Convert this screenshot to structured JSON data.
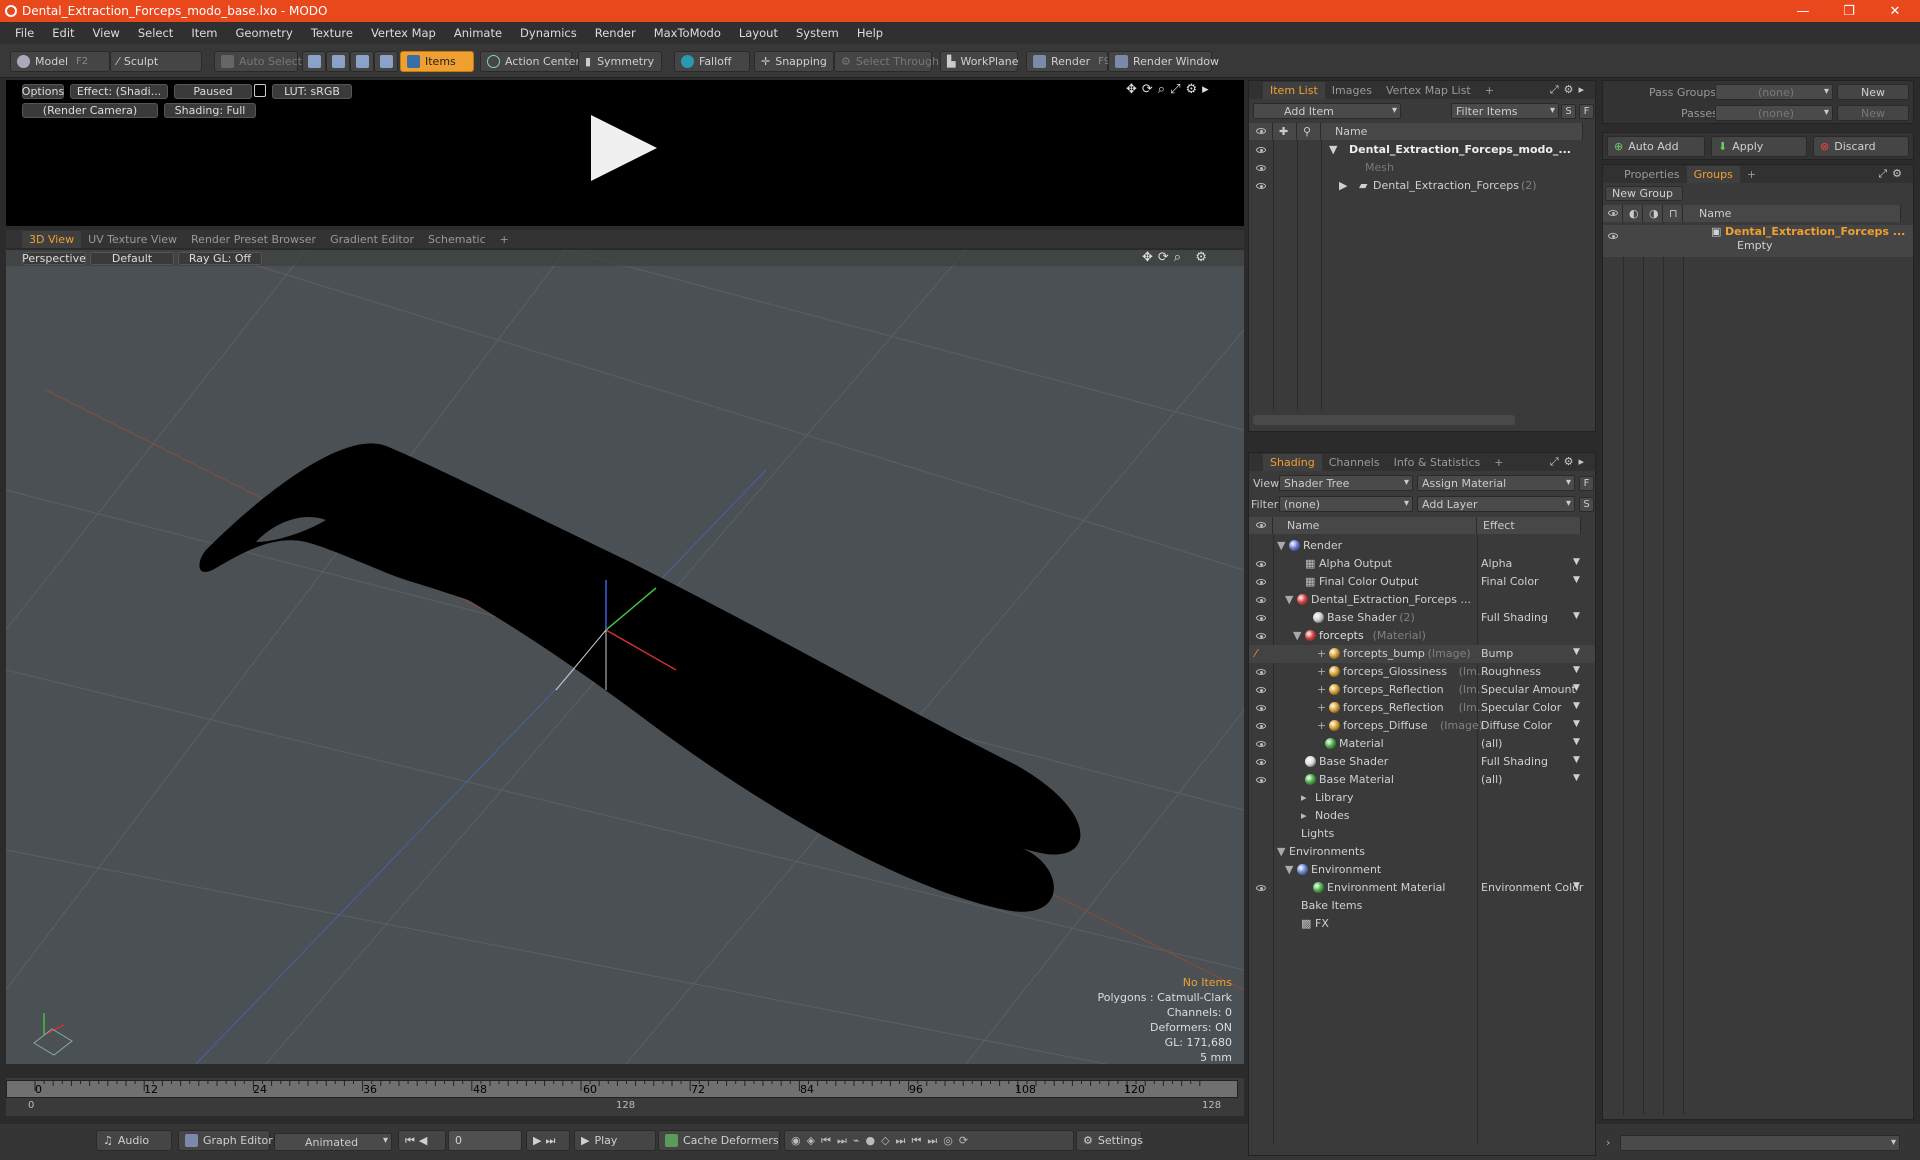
{
  "window": {
    "title": "Dental_Extraction_Forceps_modo_base.lxo - MODO",
    "min": "—",
    "max": "❐",
    "close": "✕"
  },
  "menu": [
    "File",
    "Edit",
    "View",
    "Select",
    "Item",
    "Geometry",
    "Texture",
    "Vertex Map",
    "Animate",
    "Dynamics",
    "Render",
    "MaxToModo",
    "Layout",
    "System",
    "Help"
  ],
  "toolbar": {
    "model": "Model",
    "model_key": "F2",
    "sculpt": "Sculpt",
    "auto_select": "Auto Select",
    "items": "Items",
    "action_center": "Action Center",
    "symmetry": "Symmetry",
    "falloff": "Falloff",
    "snapping": "Snapping",
    "select_through": "Select Through",
    "workplane": "WorkPlane",
    "render": "Render",
    "render_key": "F9",
    "render_window": "Render Window"
  },
  "preview": {
    "options": "Options",
    "effect": "Effect: (Shadi...",
    "paused": "Paused",
    "lut": "LUT: sRGB",
    "camera": "(Render Camera)",
    "shading": "Shading: Full"
  },
  "viewport_tabs": [
    "3D View",
    "UV Texture View",
    "Render Preset Browser",
    "Gradient Editor",
    "Schematic",
    "+"
  ],
  "viewport": {
    "perspective": "Perspective",
    "default": "Default",
    "raygl": "Ray GL: Off"
  },
  "hud": {
    "no_items": "No Items",
    "polygons": "Polygons : Catmull-Clark",
    "channels": "Channels: 0",
    "deformers": "Deformers: ON",
    "gl": "GL: 171,680",
    "scale": "5 mm"
  },
  "timeline": {
    "ticks": [
      "0",
      "12",
      "24",
      "36",
      "48",
      "60",
      "72",
      "84",
      "96",
      "108",
      "120"
    ],
    "start": "0",
    "mid": "128",
    "end": "128"
  },
  "bottom": {
    "audio": "Audio",
    "graph_editor": "Graph Editor",
    "animated": "Animated",
    "frame": "0",
    "play": "Play",
    "cache": "Cache Deformers",
    "settings": "Settings"
  },
  "item_panel": {
    "tabs": [
      "Item List",
      "Images",
      "Vertex Map List",
      "+"
    ],
    "add_item": "Add Item",
    "filter_items": "Filter Items",
    "s": "S",
    "f": "F",
    "col_name": "Name",
    "rows": [
      {
        "label": "Dental_Extraction_Forceps_modo_...",
        "sub": ""
      },
      {
        "label": "Mesh",
        "sub": ""
      },
      {
        "label": "Dental_Extraction_Forceps",
        "sub": "(2)"
      }
    ]
  },
  "shading_panel": {
    "tabs": [
      "Shading",
      "Channels",
      "Info & Statistics",
      "+"
    ],
    "view_label": "View",
    "view": "Shader Tree",
    "assign": "Assign Material",
    "filter_label": "Filter",
    "filter": "(none)",
    "add_layer": "Add Layer",
    "col_name": "Name",
    "col_effect": "Effect",
    "rows": [
      {
        "label": "Render",
        "sub": "",
        "effect": ""
      },
      {
        "label": "Alpha Output",
        "sub": "",
        "effect": "Alpha"
      },
      {
        "label": "Final Color Output",
        "sub": "",
        "effect": "Final Color"
      },
      {
        "label": "Dental_Extraction_Forceps ...",
        "sub": "",
        "effect": ""
      },
      {
        "label": "Base Shader",
        "sub": "(2)",
        "effect": "Full Shading"
      },
      {
        "label": "forcepts",
        "sub": "(Material)",
        "effect": ""
      },
      {
        "label": "forcepts_bump",
        "sub": "(Image)",
        "effect": "Bump"
      },
      {
        "label": "forceps_Glossiness",
        "sub": "(Im...",
        "effect": "Roughness"
      },
      {
        "label": "forceps_Reflection",
        "sub": "(Im...",
        "effect": "Specular Amount"
      },
      {
        "label": "forceps_Reflection",
        "sub": "(Im...",
        "effect": "Specular Color"
      },
      {
        "label": "forceps_Diffuse",
        "sub": "(Image)",
        "effect": "Diffuse Color"
      },
      {
        "label": "Material",
        "sub": "",
        "effect": "(all)"
      },
      {
        "label": "Base Shader",
        "sub": "",
        "effect": "Full Shading"
      },
      {
        "label": "Base Material",
        "sub": "",
        "effect": "(all)"
      },
      {
        "label": "Library",
        "sub": "",
        "effect": ""
      },
      {
        "label": "Nodes",
        "sub": "",
        "effect": ""
      },
      {
        "label": "Lights",
        "sub": "",
        "effect": ""
      },
      {
        "label": "Environments",
        "sub": "",
        "effect": ""
      },
      {
        "label": "Environment",
        "sub": "",
        "effect": ""
      },
      {
        "label": "Environment Material",
        "sub": "",
        "effect": "Environment Color"
      },
      {
        "label": "Bake Items",
        "sub": "",
        "effect": ""
      },
      {
        "label": "FX",
        "sub": "",
        "effect": ""
      }
    ]
  },
  "right_panel": {
    "pass_groups": "Pass Groups",
    "passes": "Passes",
    "none1": "(none)",
    "none2": "(none)",
    "new1": "New",
    "new2": "New",
    "auto_add": "Auto Add",
    "apply": "Apply",
    "discard": "Discard",
    "tabs": [
      "Properties",
      "Groups",
      "+"
    ],
    "new_group": "New Group",
    "col_name": "Name",
    "group_name": "Dental_Extraction_Forceps ...",
    "group_sub": "Empty"
  }
}
